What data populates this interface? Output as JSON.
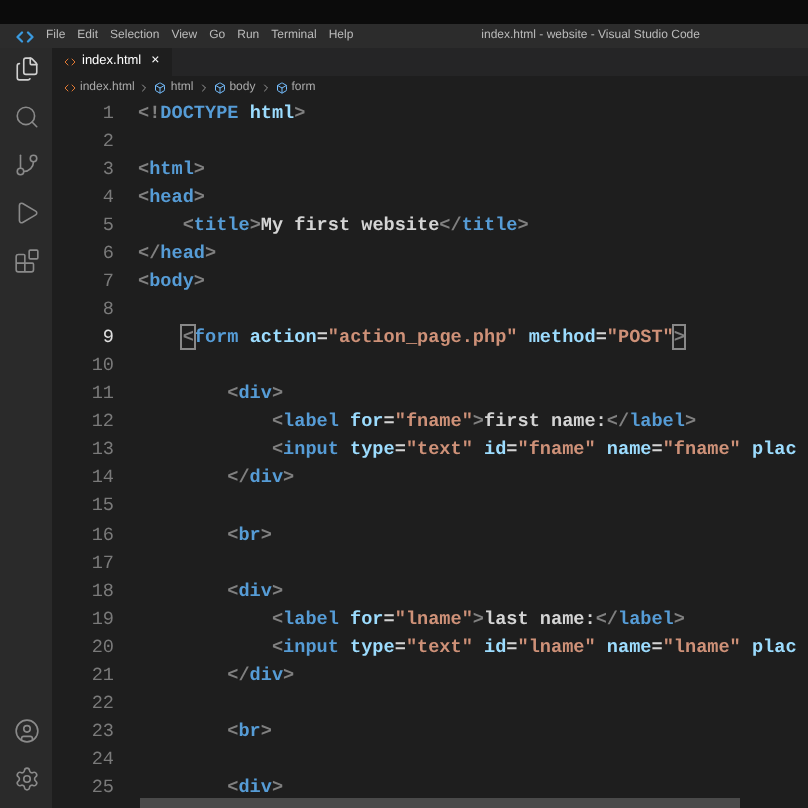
{
  "title_bar": {
    "menu": [
      "File",
      "Edit",
      "Selection",
      "View",
      "Go",
      "Run",
      "Terminal",
      "Help"
    ],
    "title": "index.html - website - Visual Studio Code"
  },
  "tabs": [
    {
      "label": "index.html",
      "selected": true,
      "close": "×"
    }
  ],
  "breadcrumb": [
    "index.html",
    "html",
    "body",
    "form"
  ],
  "lines": [
    {
      "number": "1",
      "active": false,
      "tokens": [
        {
          "kind": "punct",
          "text": "<!"
        },
        {
          "kind": "tag",
          "text": "DOCTYPE"
        },
        {
          "kind": "attr",
          "text": " html"
        },
        {
          "kind": "punct",
          "text": ">"
        }
      ]
    },
    {
      "number": "2",
      "active": false
    },
    {
      "number": "3",
      "active": false,
      "tokens": [
        {
          "kind": "punct",
          "text": "<"
        },
        {
          "kind": "tag",
          "text": "html"
        },
        {
          "kind": "punct",
          "text": ">"
        }
      ]
    },
    {
      "number": "4",
      "active": false,
      "tokens": [
        {
          "kind": "punct",
          "text": "<"
        },
        {
          "kind": "tag",
          "text": "head"
        },
        {
          "kind": "punct",
          "text": ">"
        }
      ]
    },
    {
      "number": "5",
      "active": false,
      "tokens": [
        {
          "kind": "punct",
          "text": "    <"
        },
        {
          "kind": "tag",
          "text": "title"
        },
        {
          "kind": "punct",
          "text": ">"
        },
        {
          "kind": "text",
          "text": "My first website"
        },
        {
          "kind": "punct",
          "text": "</"
        },
        {
          "kind": "tag",
          "text": "title"
        },
        {
          "kind": "punct",
          "text": ">"
        }
      ]
    },
    {
      "number": "6",
      "active": false,
      "tokens": [
        {
          "kind": "punct",
          "text": "</"
        },
        {
          "kind": "tag",
          "text": "head"
        },
        {
          "kind": "punct",
          "text": ">"
        }
      ]
    },
    {
      "number": "7",
      "active": false,
      "tokens": [
        {
          "kind": "punct",
          "text": "<"
        },
        {
          "kind": "tag",
          "text": "body"
        },
        {
          "kind": "punct",
          "text": ">"
        }
      ]
    },
    {
      "number": "8",
      "active": false
    },
    {
      "number": "9",
      "active": true,
      "tokens": [
        {
          "kind": "bracket",
          "text": "    <"
        },
        {
          "kind": "tag",
          "text": "form"
        },
        {
          "kind": "attr",
          "text": " action"
        },
        {
          "kind": "text",
          "text": "="
        },
        {
          "kind": "string",
          "text": "\"action_page.php\""
        },
        {
          "kind": "attr",
          "text": " method"
        },
        {
          "kind": "text",
          "text": "="
        },
        {
          "kind": "string",
          "text": "\"POST\""
        },
        {
          "kind": "bracket",
          "text": ">"
        }
      ]
    },
    {
      "number": "10",
      "active": false
    },
    {
      "number": "11",
      "active": false,
      "tokens": [
        {
          "kind": "punct",
          "text": "        <"
        },
        {
          "kind": "tag",
          "text": "div"
        },
        {
          "kind": "punct",
          "text": ">"
        }
      ]
    },
    {
      "number": "12",
      "active": false,
      "tokens": [
        {
          "kind": "punct",
          "text": "            <"
        },
        {
          "kind": "tag",
          "text": "label"
        },
        {
          "kind": "attr",
          "text": " for"
        },
        {
          "kind": "text",
          "text": "="
        },
        {
          "kind": "string",
          "text": "\"fname\""
        },
        {
          "kind": "punct",
          "text": ">"
        },
        {
          "kind": "text",
          "text": "first name:"
        },
        {
          "kind": "punct",
          "text": "</"
        },
        {
          "kind": "tag",
          "text": "label"
        },
        {
          "kind": "punct",
          "text": ">"
        }
      ]
    },
    {
      "number": "13",
      "active": false,
      "tokens": [
        {
          "kind": "punct",
          "text": "            <"
        },
        {
          "kind": "tag",
          "text": "input"
        },
        {
          "kind": "attr",
          "text": " type"
        },
        {
          "kind": "text",
          "text": "="
        },
        {
          "kind": "string",
          "text": "\"text\""
        },
        {
          "kind": "attr",
          "text": " id"
        },
        {
          "kind": "text",
          "text": "="
        },
        {
          "kind": "string",
          "text": "\"fname\""
        },
        {
          "kind": "attr",
          "text": " name"
        },
        {
          "kind": "text",
          "text": "="
        },
        {
          "kind": "string",
          "text": "\"fname\""
        },
        {
          "kind": "attr",
          "text": " plac"
        }
      ]
    },
    {
      "number": "14",
      "active": false,
      "tokens": [
        {
          "kind": "punct",
          "text": "        </"
        },
        {
          "kind": "tag",
          "text": "div"
        },
        {
          "kind": "punct",
          "text": ">"
        }
      ]
    },
    {
      "number": "15",
      "active": false
    },
    {
      "number": "16",
      "active": false,
      "tokens": [
        {
          "kind": "punct",
          "text": "        <"
        },
        {
          "kind": "tag",
          "text": "br"
        },
        {
          "kind": "punct",
          "text": ">"
        }
      ]
    },
    {
      "number": "17",
      "active": false
    },
    {
      "number": "18",
      "active": false,
      "tokens": [
        {
          "kind": "punct",
          "text": "        <"
        },
        {
          "kind": "tag",
          "text": "div"
        },
        {
          "kind": "punct",
          "text": ">"
        }
      ]
    },
    {
      "number": "19",
      "active": false,
      "tokens": [
        {
          "kind": "punct",
          "text": "            <"
        },
        {
          "kind": "tag",
          "text": "label"
        },
        {
          "kind": "attr",
          "text": " for"
        },
        {
          "kind": "text",
          "text": "="
        },
        {
          "kind": "string",
          "text": "\"lname\""
        },
        {
          "kind": "punct",
          "text": ">"
        },
        {
          "kind": "text",
          "text": "last name:"
        },
        {
          "kind": "punct",
          "text": "</"
        },
        {
          "kind": "tag",
          "text": "label"
        },
        {
          "kind": "punct",
          "text": ">"
        }
      ]
    },
    {
      "number": "20",
      "active": false,
      "tokens": [
        {
          "kind": "punct",
          "text": "            <"
        },
        {
          "kind": "tag",
          "text": "input"
        },
        {
          "kind": "attr",
          "text": " type"
        },
        {
          "kind": "text",
          "text": "="
        },
        {
          "kind": "string",
          "text": "\"text\""
        },
        {
          "kind": "attr",
          "text": " id"
        },
        {
          "kind": "text",
          "text": "="
        },
        {
          "kind": "string",
          "text": "\"lname\""
        },
        {
          "kind": "attr",
          "text": " name"
        },
        {
          "kind": "text",
          "text": "="
        },
        {
          "kind": "string",
          "text": "\"lname\""
        },
        {
          "kind": "attr",
          "text": " plac"
        }
      ]
    },
    {
      "number": "21",
      "active": false,
      "tokens": [
        {
          "kind": "punct",
          "text": "        </"
        },
        {
          "kind": "tag",
          "text": "div"
        },
        {
          "kind": "punct",
          "text": ">"
        }
      ]
    },
    {
      "number": "22",
      "active": false
    },
    {
      "number": "23",
      "active": false,
      "tokens": [
        {
          "kind": "punct",
          "text": "        <"
        },
        {
          "kind": "tag",
          "text": "br"
        },
        {
          "kind": "punct",
          "text": ">"
        }
      ]
    },
    {
      "number": "24",
      "active": false
    },
    {
      "number": "25",
      "active": false,
      "tokens": [
        {
          "kind": "punct",
          "text": "        <"
        },
        {
          "kind": "tag",
          "text": "div"
        },
        {
          "kind": "punct",
          "text": ">"
        }
      ]
    }
  ]
}
